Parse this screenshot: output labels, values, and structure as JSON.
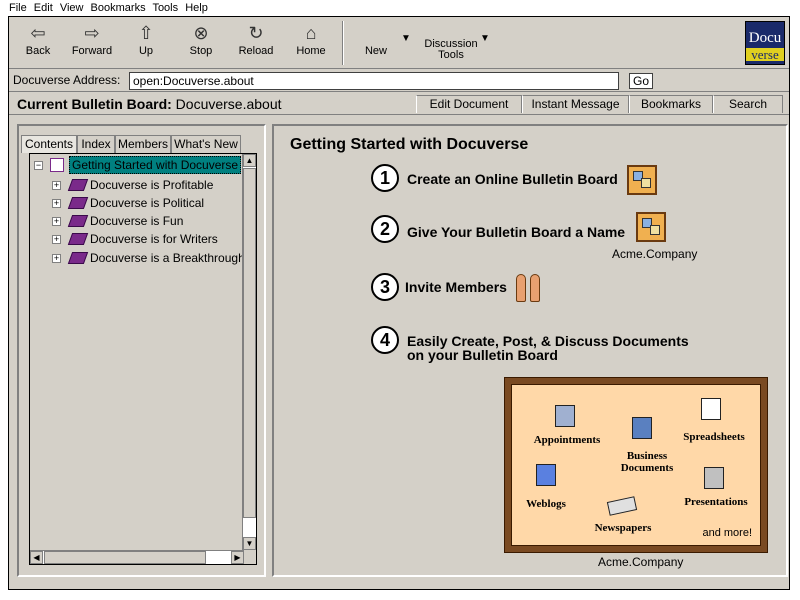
{
  "menubar": {
    "items": [
      "File",
      "Edit",
      "View",
      "Bookmarks",
      "Tools",
      "Help"
    ]
  },
  "toolbar": {
    "buttons": [
      {
        "label": "Back",
        "icon": "back-arrow-icon"
      },
      {
        "label": "Forward",
        "icon": "forward-arrow-icon"
      },
      {
        "label": "Up",
        "icon": "up-arrow-icon"
      },
      {
        "label": "Stop",
        "icon": "stop-icon"
      },
      {
        "label": "Reload",
        "icon": "reload-icon"
      },
      {
        "label": "Home",
        "icon": "home-icon"
      }
    ],
    "new_label": "New",
    "discussion_label_1": "Discussion",
    "discussion_label_2": "Tools",
    "logo_top": "Docu",
    "logo_bottom": "verse"
  },
  "address": {
    "label": "Docuverse Address:",
    "value": "open:Docuverse.about",
    "go": "Go"
  },
  "board": {
    "title_bold": "Current Bulletin Board:",
    "title_name": "Docuverse.about",
    "tabs": [
      "Edit Document",
      "Instant Message",
      "Bookmarks",
      "Search"
    ]
  },
  "left": {
    "tabs": [
      "Contents",
      "Index",
      "Members",
      "What's New"
    ],
    "root": "Getting Started with Docuverse",
    "items": [
      "Docuverse is Profitable",
      "Docuverse is Political",
      "Docuverse is Fun",
      "Docuverse is for Writers",
      "Docuverse is a Breakthrough"
    ]
  },
  "main": {
    "title": "Getting Started with Docuverse",
    "steps": [
      {
        "num": "1",
        "text": "Create an Online Bulletin Board"
      },
      {
        "num": "2",
        "text": "Give Your Bulletin Board a Name"
      },
      {
        "num": "3",
        "text": "Invite Members"
      },
      {
        "num": "4",
        "text_1": "Easily Create, Post, & Discuss Documents",
        "text_2": "on your Bulletin Board"
      }
    ],
    "step2_caption": "Acme.Company",
    "panel": {
      "items": [
        "Appointments",
        "Business Documents",
        "Spreadsheets",
        "Weblogs",
        "Presentations",
        "Newspapers"
      ],
      "more": "and more!"
    },
    "panel_caption": "Acme.Company"
  },
  "colors": {
    "chrome": "#d4d0c8",
    "selection": "#008080",
    "panel_frame": "#7a4a22",
    "panel_fill": "#ffd8a8",
    "book": "#7a2a8a"
  }
}
